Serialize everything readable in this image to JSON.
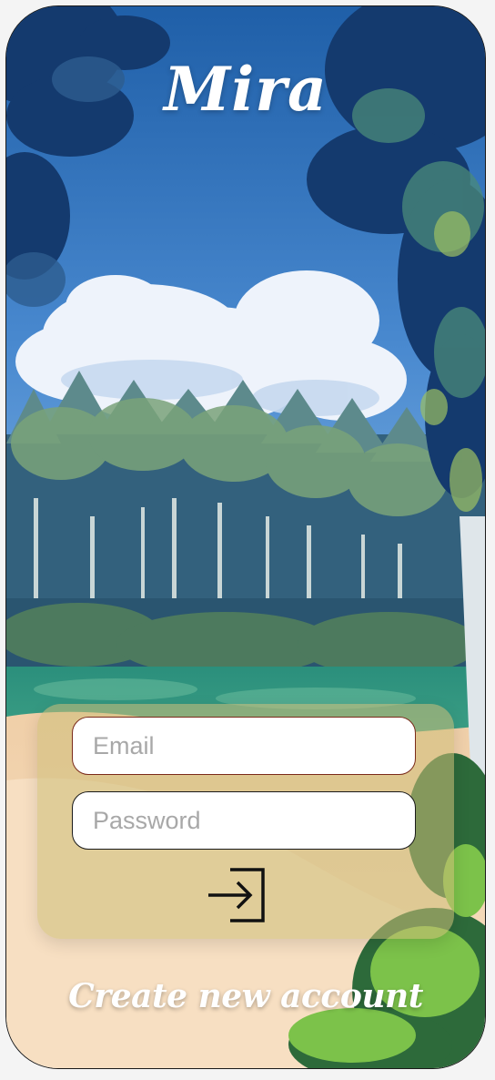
{
  "app": {
    "title": "Mira"
  },
  "login": {
    "email_placeholder": "Email",
    "password_placeholder": "Password",
    "submit_icon": "login-arrow-icon"
  },
  "footer": {
    "create_account_label": "Create new account"
  },
  "theme": {
    "sky": "#2f74c0",
    "cloud": "#eef3fb",
    "forest": "#2e5a74",
    "meadow": "#2f9a80",
    "path": "#f3d6b5",
    "panel": "#cdbe78",
    "email_border": "#7a2a1a"
  }
}
